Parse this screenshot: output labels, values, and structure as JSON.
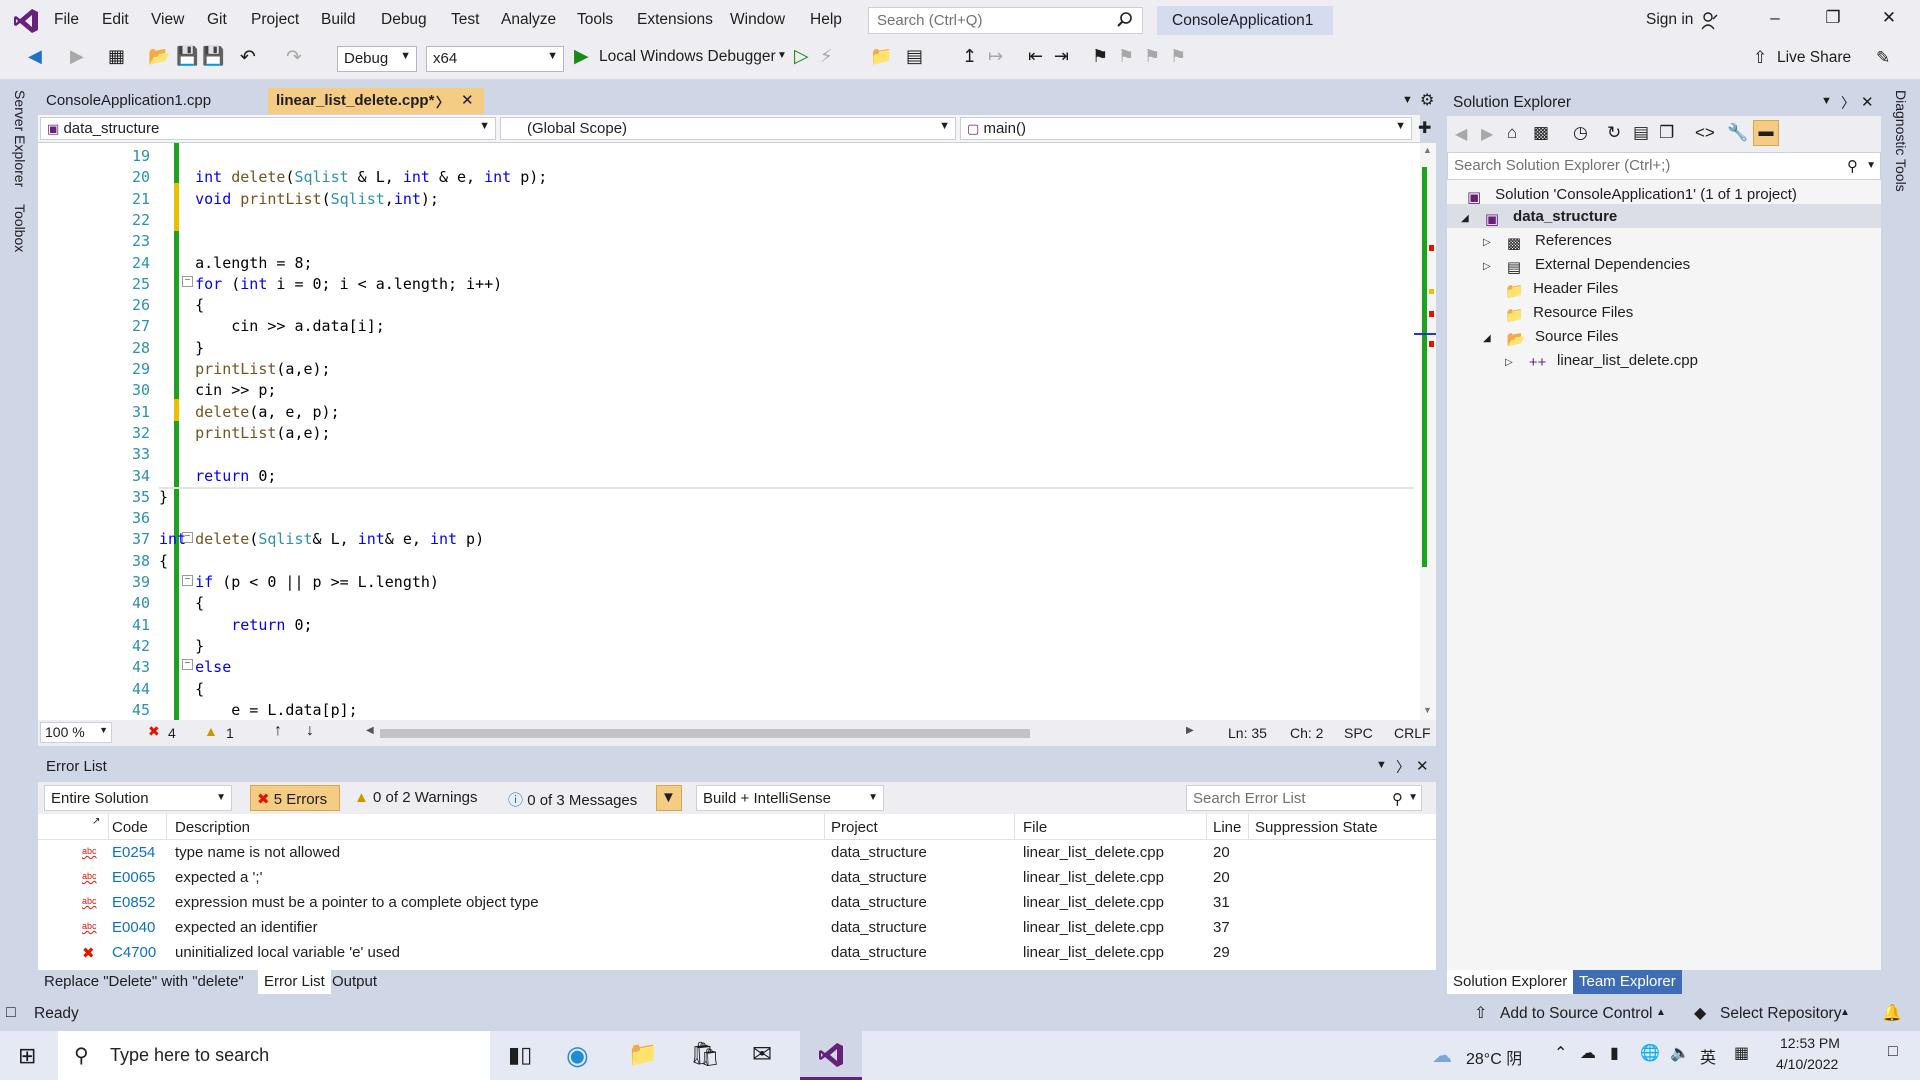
{
  "menu": {
    "items": [
      "File",
      "Edit",
      "View",
      "Git",
      "Project",
      "Build",
      "Debug",
      "Test",
      "Analyze",
      "Tools",
      "Extensions",
      "Window",
      "Help"
    ],
    "search_placeholder": "Search (Ctrl+Q)",
    "solution_title": "ConsoleApplication1",
    "sign_in": "Sign in"
  },
  "toolbar": {
    "config": "Debug",
    "platform": "x64",
    "debugger": "Local Windows Debugger",
    "live_share": "Live Share"
  },
  "left_rail": {
    "server_explorer": "Server Explorer",
    "toolbox": "Toolbox"
  },
  "right_rail": {
    "diagnostic_tools": "Diagnostic Tools"
  },
  "editor": {
    "tabs": [
      {
        "label": "ConsoleApplication1.cpp"
      },
      {
        "label": "linear_list_delete.cpp*"
      }
    ],
    "nav": {
      "project": "data_structure",
      "scope": "(Global Scope)",
      "member": "main()"
    },
    "zoom": "100 %",
    "error_count": "4",
    "warning_count": "1",
    "position": {
      "ln": "Ln: 35",
      "ch": "Ch: 2",
      "spc": "SPC",
      "crlf": "CRLF"
    },
    "lines": [
      {
        "n": "19",
        "t": ""
      },
      {
        "n": "20",
        "t": "    int delete(Sqlist & L, int & e, int p);"
      },
      {
        "n": "21",
        "t": "    void printList(Sqlist,int);"
      },
      {
        "n": "22",
        "t": ""
      },
      {
        "n": "23",
        "t": ""
      },
      {
        "n": "24",
        "t": "    a.length = 8;"
      },
      {
        "n": "25",
        "t": "    for (int i = 0; i < a.length; i++)"
      },
      {
        "n": "26",
        "t": "    {"
      },
      {
        "n": "27",
        "t": "        cin >> a.data[i];"
      },
      {
        "n": "28",
        "t": "    }"
      },
      {
        "n": "29",
        "t": "    printList(a,e);"
      },
      {
        "n": "30",
        "t": "    cin >> p;"
      },
      {
        "n": "31",
        "t": "    delete(a, e, p);"
      },
      {
        "n": "32",
        "t": "    printList(a,e);"
      },
      {
        "n": "33",
        "t": ""
      },
      {
        "n": "34",
        "t": "    return 0;"
      },
      {
        "n": "35",
        "t": "}"
      },
      {
        "n": "36",
        "t": ""
      },
      {
        "n": "37",
        "t": "int delete(Sqlist& L, int& e, int p)"
      },
      {
        "n": "38",
        "t": "{"
      },
      {
        "n": "39",
        "t": "    if (p < 0 || p >= L.length)"
      },
      {
        "n": "40",
        "t": "    {"
      },
      {
        "n": "41",
        "t": "        return 0;"
      },
      {
        "n": "42",
        "t": "    }"
      },
      {
        "n": "43",
        "t": "    else"
      },
      {
        "n": "44",
        "t": "    {"
      },
      {
        "n": "45",
        "t": "        e = L.data[p];"
      }
    ]
  },
  "error_list": {
    "title": "Error List",
    "scope": "Entire Solution",
    "errors_btn": "5 Errors",
    "warnings_btn": "0 of 2 Warnings",
    "messages_btn": "0 of 3 Messages",
    "build_filter": "Build + IntelliSense",
    "search_placeholder": "Search Error List",
    "columns": [
      "Code",
      "Description",
      "Project",
      "File",
      "Line",
      "Suppression State"
    ],
    "rows": [
      {
        "code": "E0254",
        "desc": "type name is not allowed",
        "project": "data_structure",
        "file": "linear_list_delete.cpp",
        "line": "20",
        "kind": "intellisense"
      },
      {
        "code": "E0065",
        "desc": "expected a ';'",
        "project": "data_structure",
        "file": "linear_list_delete.cpp",
        "line": "20",
        "kind": "intellisense"
      },
      {
        "code": "E0852",
        "desc": "expression must be a pointer to a complete object type",
        "project": "data_structure",
        "file": "linear_list_delete.cpp",
        "line": "31",
        "kind": "intellisense"
      },
      {
        "code": "E0040",
        "desc": "expected an identifier",
        "project": "data_structure",
        "file": "linear_list_delete.cpp",
        "line": "37",
        "kind": "intellisense"
      },
      {
        "code": "C4700",
        "desc": "uninitialized local variable 'e' used",
        "project": "data_structure",
        "file": "linear_list_delete.cpp",
        "line": "29",
        "kind": "build"
      }
    ]
  },
  "bottom_tabs": [
    "Replace \"Delete\" with \"delete\"",
    "Error List",
    "Output"
  ],
  "solution_explorer": {
    "title": "Solution Explorer",
    "search_placeholder": "Search Solution Explorer (Ctrl+;)",
    "solution": "Solution 'ConsoleApplication1' (1 of 1 project)",
    "project": "data_structure",
    "items": [
      "References",
      "External Dependencies",
      "Header Files",
      "Resource Files",
      "Source Files"
    ],
    "file": "linear_list_delete.cpp",
    "bottom_tabs": [
      "Solution Explorer",
      "Team Explorer"
    ]
  },
  "status": {
    "ready": "Ready",
    "source_control": "Add to Source Control",
    "repo": "Select Repository"
  },
  "taskbar": {
    "search": "Type here to search",
    "weather": "28°C 阴",
    "ime": "英",
    "time": "12:53 PM",
    "date": "4/10/2022"
  },
  "colors": {
    "accent": "#68217a",
    "tab_active": "#f5cc84",
    "error": "#e51400",
    "link": "#0e70c0"
  }
}
